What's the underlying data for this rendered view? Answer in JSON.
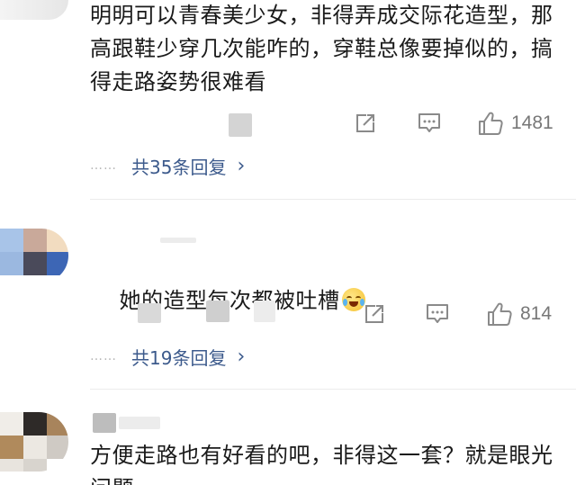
{
  "comments": [
    {
      "text": "明明可以青春美少女，非得弄成交际花造型，那高跟鞋少穿几次能咋的，穿鞋总像要掉似的，搞得走路姿势很难看",
      "likes": "1481",
      "replies_label": "共35条回复",
      "replies_chevron": "›",
      "dots": "……",
      "actions": {
        "share_icon": "share-icon",
        "comment_icon": "comment-icon",
        "like_icon": "thumbs-up-icon"
      }
    },
    {
      "text": "她的造型每次都被吐槽",
      "emoji": "crying-laughing-emoji",
      "likes": "814",
      "replies_label": "共19条回复",
      "replies_chevron": "›",
      "dots": "……",
      "avatar_colors": [
        "#a8c4e8",
        "#c9a99a",
        "#f2dcc0",
        "#9bb8e0",
        "#4a4a5a",
        "#3d66b5"
      ]
    },
    {
      "text": "方便走路也有好看的吧，非得这一套？就是眼光问题",
      "avatar_colors": [
        "#f0ede8",
        "#2e2a28",
        "#a8845c",
        "#b08a5c",
        "#ece8e2",
        "#cfcac4"
      ]
    }
  ],
  "colors": {
    "link": "#3c5a8c",
    "icon": "#8a8a8a",
    "text": "#1a1a1a",
    "count": "#777777"
  }
}
